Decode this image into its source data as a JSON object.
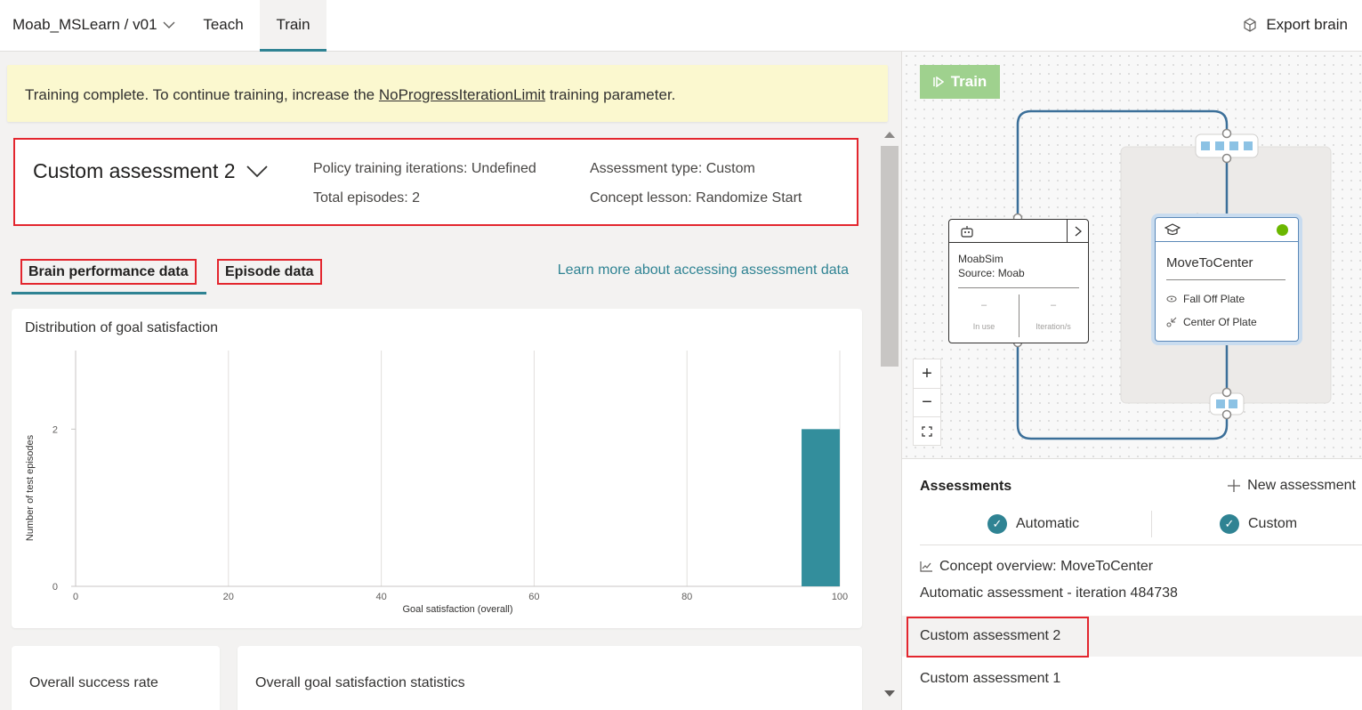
{
  "header": {
    "project": "Moab_MSLearn / v01",
    "tabs": [
      {
        "label": "Teach"
      },
      {
        "label": "Train"
      }
    ],
    "export_label": "Export brain"
  },
  "banner": {
    "text_before": "Training complete. To continue training, increase the ",
    "link": "NoProgressIterationLimit",
    "text_after": " training parameter."
  },
  "assessment": {
    "title": "Custom assessment 2",
    "policy_iterations": "Policy training iterations: Undefined",
    "total_episodes": "Total episodes: 2",
    "assessment_type": "Assessment type: Custom",
    "concept_lesson": "Concept lesson: Randomize Start"
  },
  "data_tabs": {
    "brain": "Brain performance data",
    "episode": "Episode data",
    "learn_more": "Learn more about accessing assessment data"
  },
  "chart_data": {
    "type": "bar",
    "title": "Distribution of goal satisfaction",
    "xlabel": "Goal satisfaction (overall)",
    "ylabel": "Number of test episodes",
    "xlim": [
      0,
      100
    ],
    "ylim": [
      0,
      3
    ],
    "x_ticks": [
      "0",
      "20",
      "40",
      "60",
      "80",
      "100"
    ],
    "y_ticks": [
      "0",
      "2"
    ],
    "bins": [
      {
        "from": 95,
        "to": 100,
        "value": 2
      }
    ],
    "bar_color": "#338e9c"
  },
  "stats": {
    "success_rate": "Overall success rate",
    "goal_stats": "Overall goal satisfaction statistics"
  },
  "graph": {
    "train_label": "Train",
    "sim": {
      "name": "MoabSim",
      "source": "Source: Moab",
      "stat1_value": "–",
      "stat1_label": "In use",
      "stat2_value": "–",
      "stat2_label": "Iteration/s"
    },
    "concept": {
      "name": "MoveToCenter",
      "goal1": "Fall Off Plate",
      "goal2": "Center Of Plate",
      "status_color": "#6bb700"
    },
    "zoom": {
      "in": "+",
      "out": "−"
    }
  },
  "assessments_panel": {
    "title": "Assessments",
    "new_label": "New assessment",
    "filter_auto": "Automatic",
    "filter_custom": "Custom",
    "concept_overview": "Concept overview: MoveToCenter",
    "items": [
      {
        "label": "Automatic assessment - iteration 484738"
      },
      {
        "label": "Custom assessment 2"
      },
      {
        "label": "Custom assessment 1"
      }
    ]
  }
}
